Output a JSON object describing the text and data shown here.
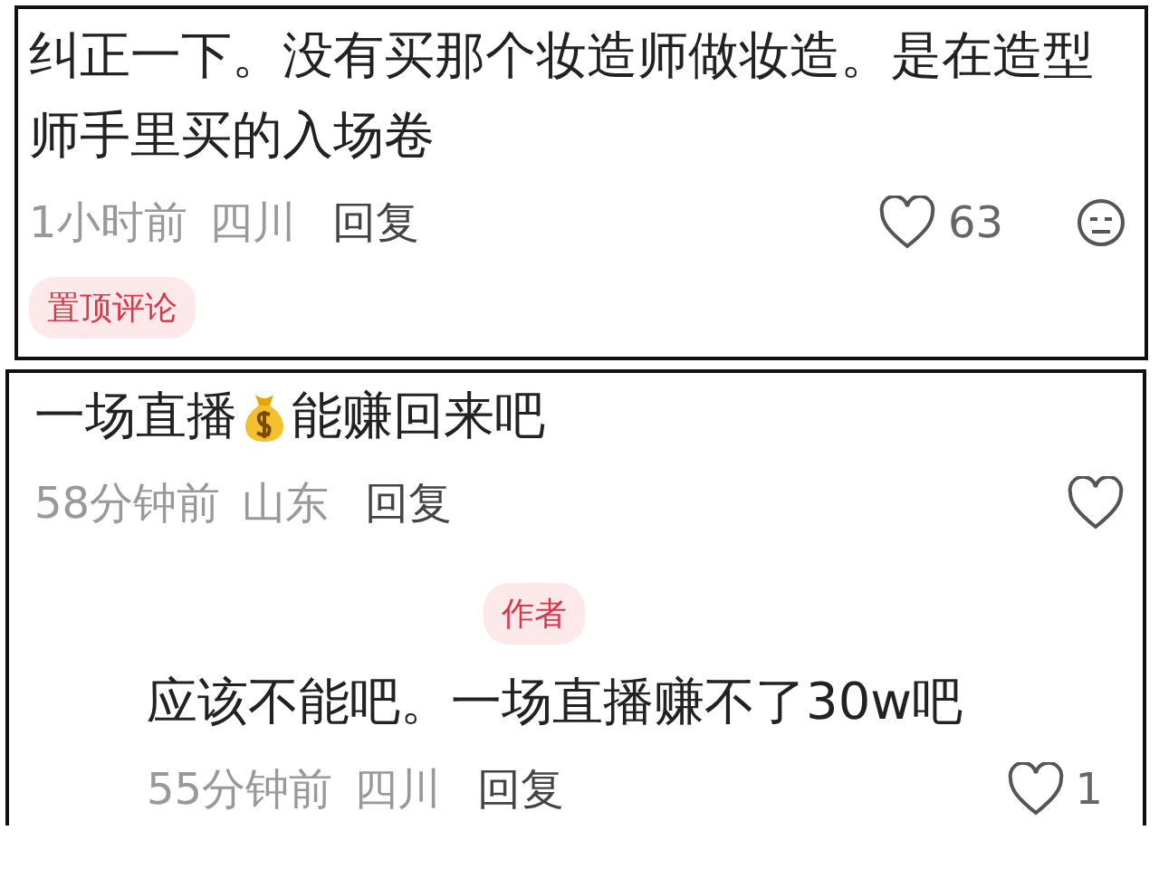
{
  "comments": [
    {
      "segments": [
        {
          "kind": "text",
          "text": "纠正一下。没有买那个妆造师做妆造。是在造型师手里买的入场卷"
        }
      ],
      "time": "1小时前",
      "location": "四川",
      "reply": "回复",
      "actions": [
        {
          "kind": "like",
          "count": "63"
        },
        {
          "kind": "dislike"
        }
      ],
      "tag": "置顶评论"
    },
    {
      "segments": [
        {
          "kind": "text",
          "text": "一场直播"
        },
        {
          "kind": "money-bag"
        },
        {
          "kind": "text",
          "text": "能赚回来吧"
        }
      ],
      "time": "58分钟前",
      "location": "山东",
      "reply": "回复",
      "actions": [
        {
          "kind": "like"
        }
      ],
      "replies": [
        {
          "author_tag": "作者",
          "text": "应该不能吧。一场直播赚不了30w吧",
          "time": "55分钟前",
          "location": "四川",
          "reply": "回复",
          "actions": [
            {
              "kind": "like",
              "count": "1"
            }
          ]
        }
      ]
    }
  ]
}
